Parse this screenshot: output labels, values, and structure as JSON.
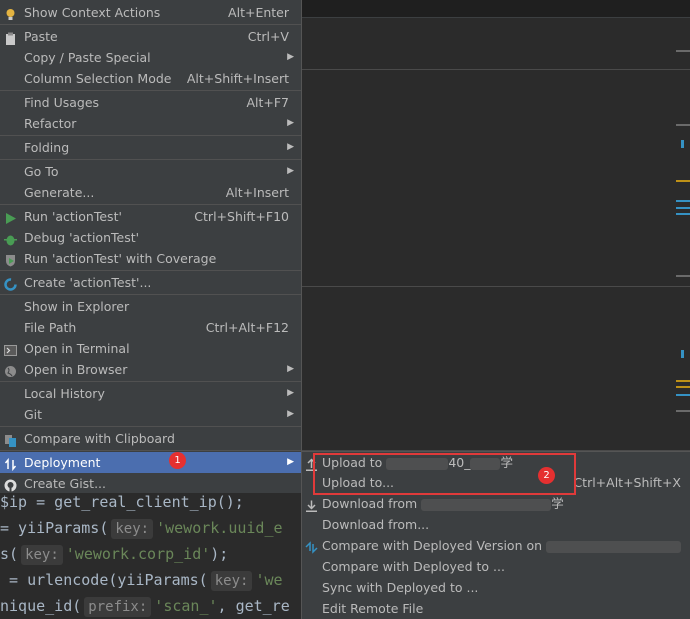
{
  "menu": {
    "items": [
      {
        "label": "Show Context Actions",
        "shortcut": "Alt+Enter",
        "icon": "bulb-icon"
      },
      {
        "label": "Paste",
        "shortcut": "Ctrl+V",
        "icon": "paste-icon"
      },
      {
        "label": "Copy / Paste Special",
        "submenu": true
      },
      {
        "label": "Column Selection Mode",
        "shortcut": "Alt+Shift+Insert"
      },
      {
        "label": "Find Usages",
        "shortcut": "Alt+F7"
      },
      {
        "label": "Refactor",
        "submenu": true
      },
      {
        "label": "Folding",
        "submenu": true
      },
      {
        "label": "Go To",
        "submenu": true
      },
      {
        "label": "Generate...",
        "shortcut": "Alt+Insert"
      },
      {
        "label": "Run 'actionTest'",
        "shortcut": "Ctrl+Shift+F10",
        "icon": "run-icon"
      },
      {
        "label": "Debug 'actionTest'",
        "icon": "debug-icon"
      },
      {
        "label": "Run 'actionTest' with Coverage",
        "icon": "coverage-icon"
      },
      {
        "label": "Create 'actionTest'...",
        "icon": "create-config-icon"
      },
      {
        "label": "Show in Explorer"
      },
      {
        "label": "File Path",
        "shortcut": "Ctrl+Alt+F12"
      },
      {
        "label": "Open in Terminal",
        "icon": "terminal-icon"
      },
      {
        "label": "Open in Browser",
        "icon": "globe-icon",
        "submenu": true
      },
      {
        "label": "Local History",
        "submenu": true
      },
      {
        "label": "Git",
        "submenu": true
      },
      {
        "label": "Compare with Clipboard",
        "icon": "compare-icon"
      },
      {
        "label": "Deployment",
        "icon": "deployment-icon",
        "submenu": true,
        "selected": true
      },
      {
        "label": "Create Gist...",
        "icon": "github-icon"
      }
    ]
  },
  "submenu": {
    "items": [
      {
        "label": "Upload to",
        "suffix": "40_",
        "suffix2": "学",
        "icon": "upload-icon"
      },
      {
        "label": "Upload to...",
        "shortcut": "Ctrl+Alt+Shift+X"
      },
      {
        "label": "Download from",
        "suffix": "学",
        "icon": "download-icon"
      },
      {
        "label": "Download from..."
      },
      {
        "label": "Compare with Deployed Version on",
        "icon": "compare-deployed-icon"
      },
      {
        "label": "Compare with Deployed to ..."
      },
      {
        "label": "Sync with Deployed to ..."
      },
      {
        "label": "Edit Remote File"
      }
    ]
  },
  "badges": {
    "one": "1",
    "two": "2"
  },
  "code": {
    "line1": {
      "pre": "$ip = get_real_client_ip();"
    },
    "line2": {
      "pre": "= yiiParams(",
      "hint": "key:",
      "str": "'wework.uuid_e"
    },
    "line3": {
      "pre": "s(",
      "hint": "key:",
      "str": "'wework.corp_id'",
      "post": ");"
    },
    "line4": {
      "pre": " = urlencode(yiiParams(",
      "hint": "key:",
      "str": "'we"
    },
    "line5": {
      "pre": "nique_id(",
      "hint": "prefix:",
      "str": "'scan_'",
      "post": ", get_re"
    }
  },
  "colors": {
    "accent": "#4b6eaf",
    "badge": "#e53030",
    "highlight_box": "#e03a3a"
  }
}
